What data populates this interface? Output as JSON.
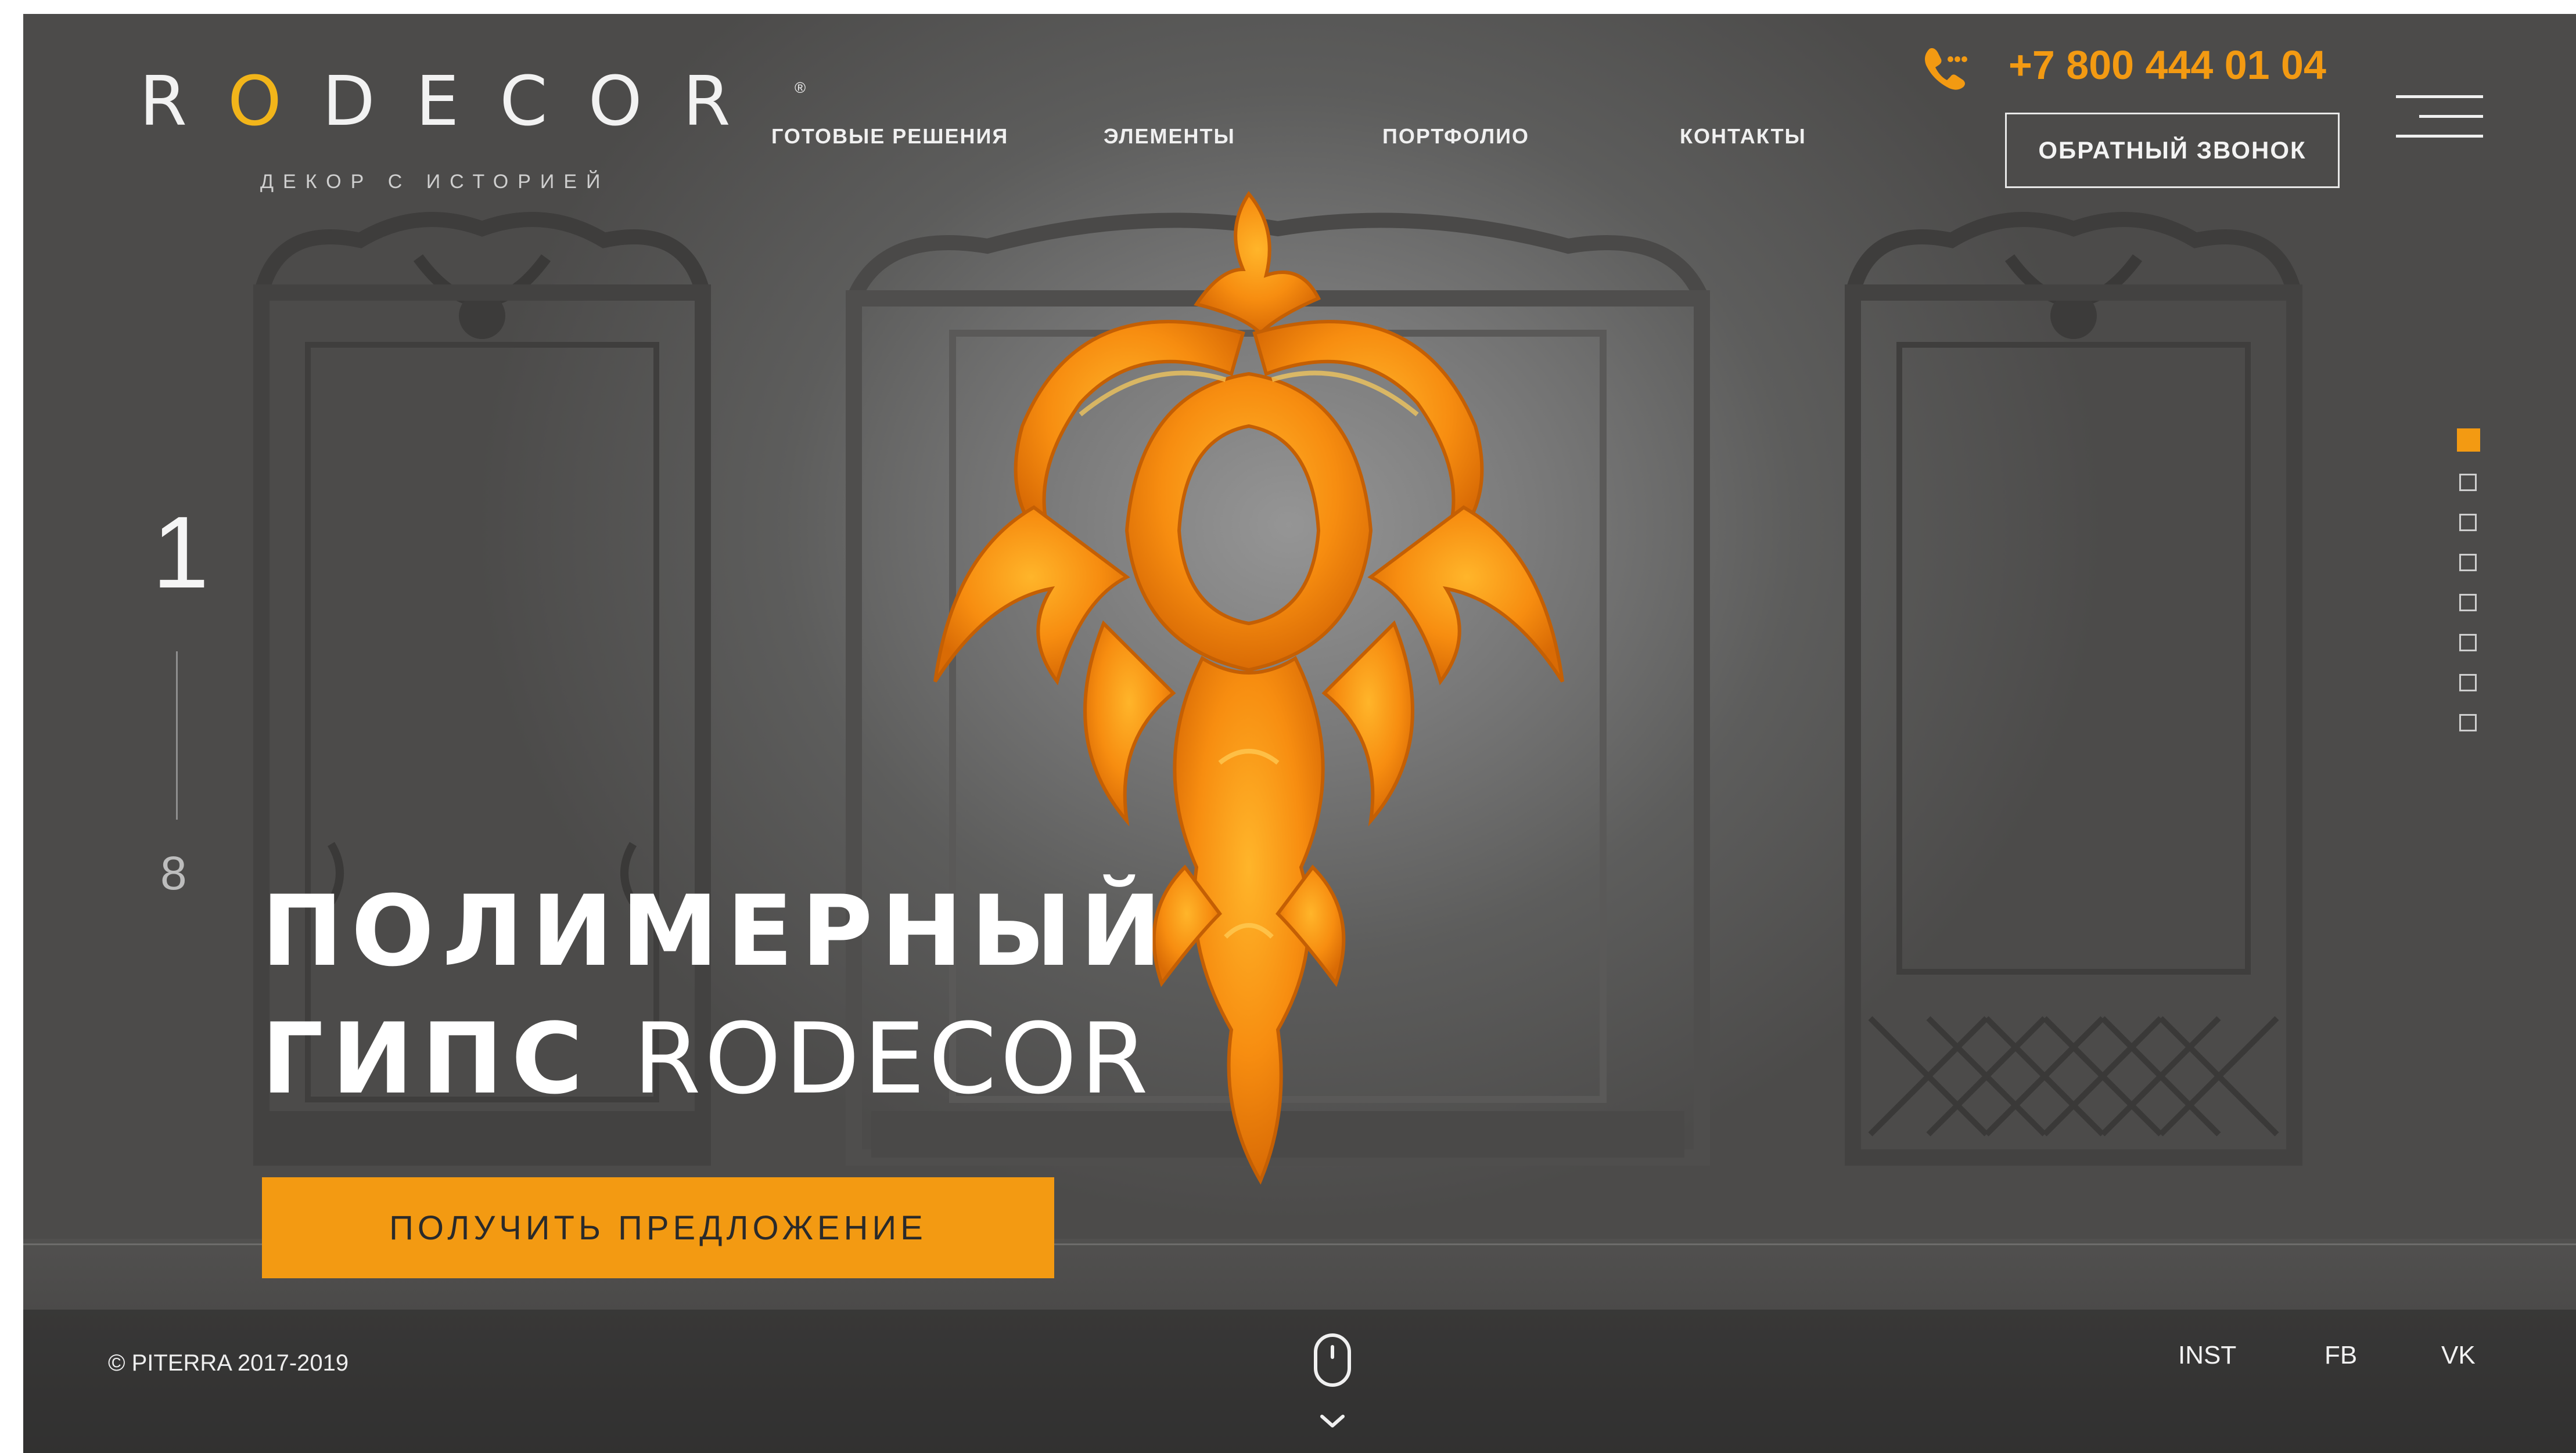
{
  "brand": {
    "logo_pre": "R",
    "logo_mark": "O",
    "logo_post": "DECOR",
    "logo_reg": "®",
    "tagline": "ДЕКОР С ИСТОРИЕЙ"
  },
  "nav": {
    "items": [
      {
        "label": "ГОТОВЫЕ РЕШЕНИЯ"
      },
      {
        "label": "ЭЛЕМЕНТЫ"
      },
      {
        "label": "ПОРТФОЛИО"
      },
      {
        "label": "КОНТАКТЫ"
      }
    ]
  },
  "header": {
    "phone": "+7 800 444 01 04",
    "callback_label": "ОБРАТНЫЙ ЗВОНОК"
  },
  "slider": {
    "current": "1",
    "total": "8",
    "active_index": 1
  },
  "hero": {
    "title_line1": "ПОЛИМЕРНЫЙ",
    "title_line2_bold": "ГИПС",
    "title_line2_light": "RODECOR",
    "cta_label": "ПОЛУЧИТЬ ПРЕДЛОЖЕНИЕ"
  },
  "footer": {
    "copyright": "© PITERRA 2017-2019",
    "social": [
      {
        "label": "INST"
      },
      {
        "label": "FB"
      },
      {
        "label": "VK"
      }
    ]
  },
  "icons": {
    "phone": "phone-icon",
    "menu": "hamburger-menu-icon",
    "scroll": "mouse-scroll-icon",
    "chevron": "chevron-down-icon"
  },
  "colors": {
    "accent": "#f39a12",
    "logo_gold": "#f2b51a",
    "background": "#5a5958",
    "text": "#ffffff"
  }
}
